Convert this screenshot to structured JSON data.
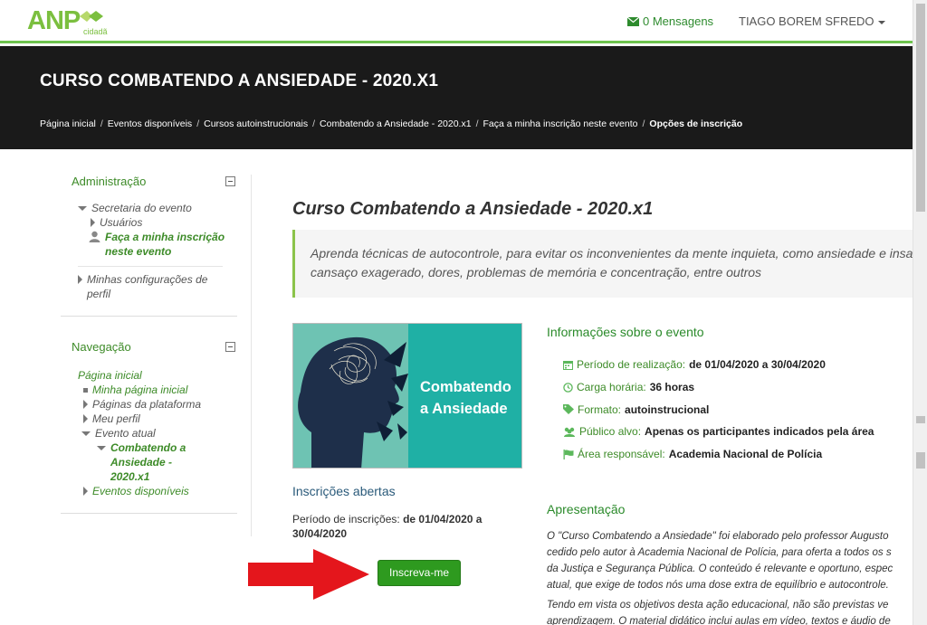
{
  "navbar": {
    "logo_text": "ANP",
    "logo_sub": "cidadã",
    "messages_label": "0 Mensagens",
    "user_name": "TIAGO BOREM SFREDO"
  },
  "header": {
    "course_title": "CURSO COMBATENDO A ANSIEDADE - 2020.X1",
    "breadcrumb": [
      "Página inicial",
      "Eventos disponíveis",
      "Cursos autoinstrucionais",
      "Combatendo a Ansiedade - 2020.x1",
      "Faça a minha inscrição neste evento",
      "Opções de inscrição"
    ]
  },
  "sidebar": {
    "admin": {
      "title": "Administração",
      "secretaria": "Secretaria do evento",
      "usuarios": "Usuários",
      "inscricao": "Faça a minha inscrição neste evento",
      "config": "Minhas configurações de perfil"
    },
    "nav": {
      "title": "Navegação",
      "home": "Página inicial",
      "my_home": "Minha página inicial",
      "platform_pages": "Páginas da plataforma",
      "profile": "Meu perfil",
      "current_event": "Evento atual",
      "course": "Combatendo a Ansiedade - 2020.x1",
      "available_events": "Eventos disponíveis"
    }
  },
  "main": {
    "title": "Curso Combatendo a Ansiedade - 2020.x1",
    "quote_line1": "Aprenda técnicas de autocontrole, para evitar os inconvenientes da mente inquieta, como ansiedade e insa",
    "quote_line2": "cansaço exagerado, dores, problemas de memória e concentração, entre outros",
    "banner_line1": "Combatendo",
    "banner_line2": "a Ansiedade",
    "inscricoes_title": "Inscrições abertas",
    "inscricoes_label": "Período de inscrições:",
    "inscricoes_value": "de 01/04/2020 a 30/04/2020",
    "enroll_button": "Inscreva-me",
    "info_title": "Informações sobre o evento",
    "info": [
      {
        "icon": "calendar-icon",
        "label": "Período de realização:",
        "value": "de 01/04/2020 a 30/04/2020"
      },
      {
        "icon": "clock-icon",
        "label": "Carga horária:",
        "value": "36 horas"
      },
      {
        "icon": "tag-icon",
        "label": "Formato:",
        "value": "autoinstrucional"
      },
      {
        "icon": "users-icon",
        "label": "Público alvo:",
        "value": "Apenas os participantes indicados pela área"
      },
      {
        "icon": "flag-icon",
        "label": "Área responsável:",
        "value": "Academia Nacional de Polícia"
      }
    ],
    "apresentacao_title": "Apresentação",
    "apresentacao_lines": [
      "O \"Curso Combatendo a Ansiedade\" foi elaborado pelo professor Augusto",
      "cedido pelo autor à Academia Nacional de Polícia, para oferta a todos os s",
      "da Justiça e Segurança Pública. O conteúdo é relevante e oportuno, espec",
      "atual, que exige de todos nós uma dose extra de equilíbrio e autocontrole."
    ],
    "apresentacao_lines2": [
      "Tendo em vista os objetivos desta ação educacional, não são previstas ve",
      "aprendizagem. O material didático inclui aulas em vídeo, textos e áudio de"
    ]
  },
  "colors": {
    "accent_green": "#3d8b28",
    "button_green": "#2e9a1f",
    "header_bg": "#1a1a1a",
    "arrow_red": "#e4161c"
  }
}
